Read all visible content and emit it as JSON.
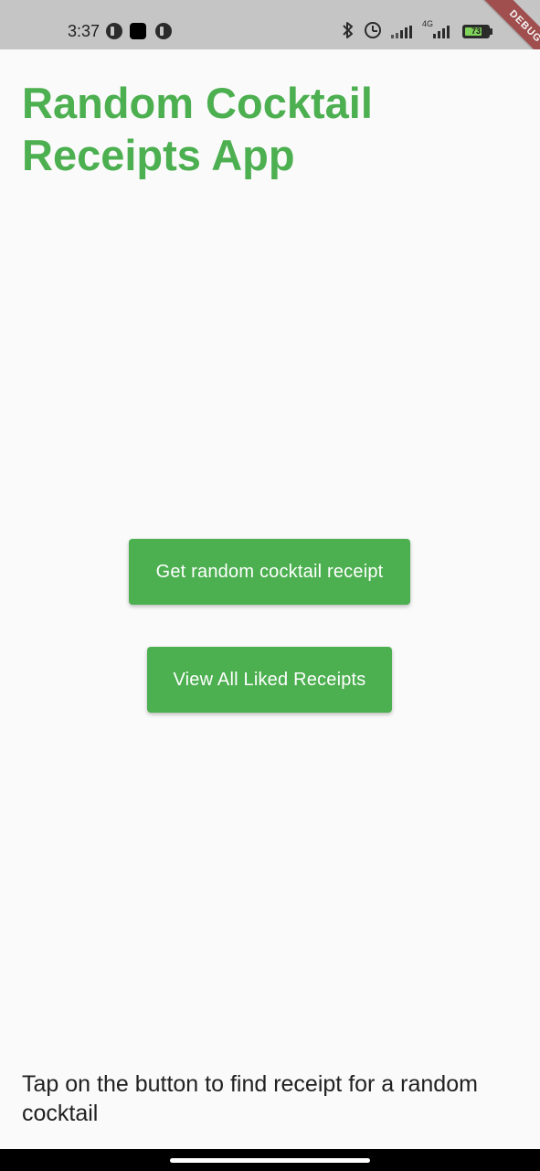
{
  "status_bar": {
    "time": "3:37",
    "network_label": "4G",
    "battery_level": "73",
    "battery_fraction": 0.73,
    "icons": [
      "app-notification-icon",
      "app-notification-icon",
      "square-notification-icon",
      "bluetooth-icon",
      "alarm-icon",
      "signal-icon",
      "signal-icon",
      "battery-icon"
    ],
    "debug_banner": "DEBUG"
  },
  "main": {
    "title": "Random Cocktail Receipts App",
    "random_button_label": "Get random cocktail receipt",
    "liked_button_label": "View All Liked Receipts",
    "hint": "Tap on the button to find receipt for a random cocktail"
  },
  "colors": {
    "accent": "#4caf50",
    "background": "#fafafa",
    "status_bar": "#c5c5c5",
    "text": "#212121"
  }
}
